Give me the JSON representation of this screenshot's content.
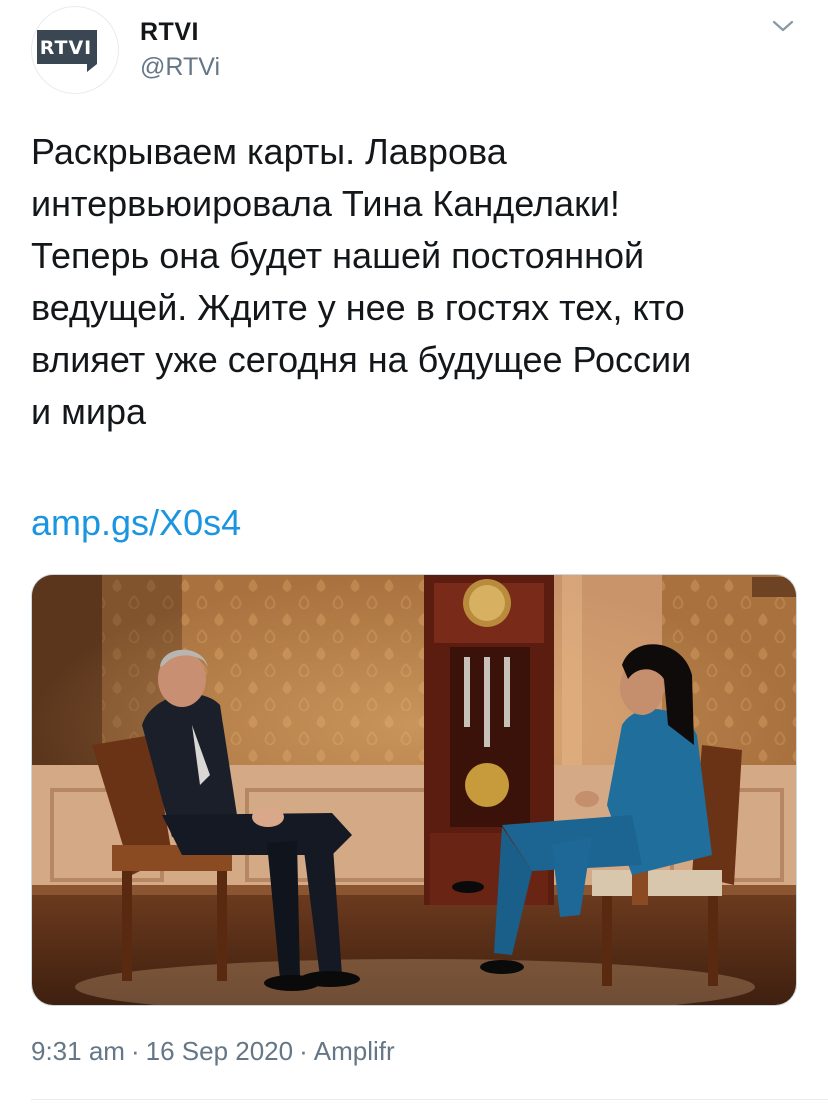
{
  "author": {
    "avatar_text": "RTVI",
    "display_name": "RTVI",
    "handle": "@RTVi"
  },
  "tweet": {
    "lines": [
      "Раскрываем карты. Лаврова",
      "интервьюировала Тина Канделаки!",
      "Теперь она будет нашей постоянной",
      "ведущей. Ждите у нее в гостях тех, кто",
      "влияет уже сегодня на будущее России",
      "и мира"
    ],
    "link": "amp.gs/X0s4"
  },
  "meta": {
    "time": "9:31 am",
    "date": "16 Sep 2020",
    "source": "Amplifr",
    "separator": "·"
  },
  "colors": {
    "text": "#14171a",
    "secondary": "#657786",
    "link": "#1b95e0",
    "logo_bg": "#3a4652"
  },
  "icons": {
    "menu": "chevron-down-icon"
  }
}
